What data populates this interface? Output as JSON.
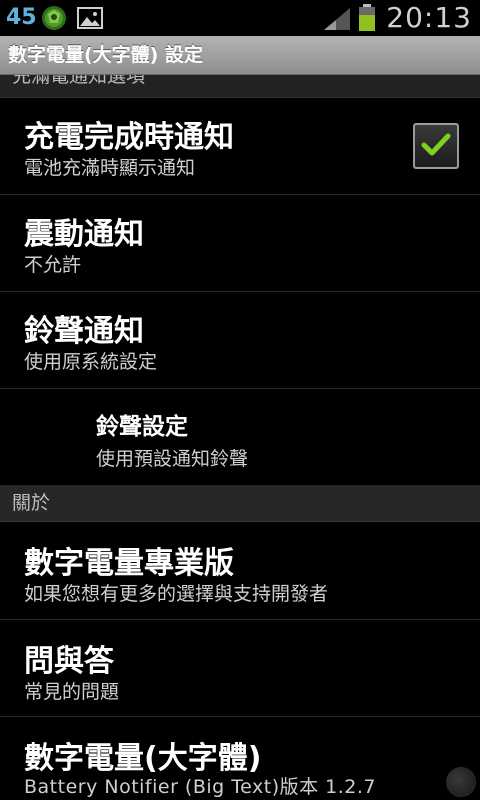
{
  "status_bar": {
    "badge": "45",
    "time": "20:13",
    "icons": [
      "app-shield-icon",
      "gallery-icon",
      "signal-icon",
      "battery-icon"
    ],
    "battery_color": "#8ec21f",
    "badge_color": "#5fb3d9"
  },
  "title_bar": {
    "title": "數字電量(大字體) 設定"
  },
  "list": {
    "partial_header": "充滿電通知選項",
    "items": [
      {
        "title": "充電完成時通知",
        "summary": "電池充滿時顯示通知",
        "checked": true
      },
      {
        "title": "震動通知",
        "summary": "不允許"
      },
      {
        "title": "鈴聲通知",
        "summary": "使用原系統設定"
      },
      {
        "title": "鈴聲設定",
        "summary": "使用預設通知鈴聲"
      }
    ],
    "category": "關於",
    "about_items": [
      {
        "title": "數字電量專業版",
        "summary": "如果您想有更多的選擇與支持開發者"
      },
      {
        "title": "問與答",
        "summary": "常見的問題"
      },
      {
        "title": "數字電量(大字體)",
        "summary": "Battery Notifier (Big Text)版本 1.2.7"
      }
    ]
  },
  "colors": {
    "checkmark": "#7ed321",
    "title_bar_bg": "#a0a0a0",
    "background": "#000000"
  }
}
